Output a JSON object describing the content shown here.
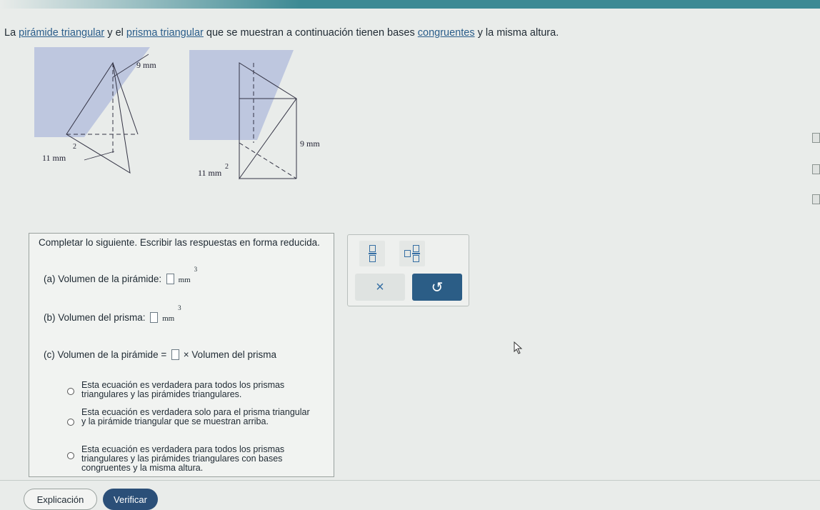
{
  "intro": {
    "part1": "La ",
    "link1": "pirámide triangular",
    "part2": " y el ",
    "link2": "prisma triangular",
    "part3": " que se muestran a continuación tienen bases ",
    "link3": "congruentes",
    "part4": " y la misma altura."
  },
  "figures": {
    "pyramid": {
      "height_label": "9 mm",
      "base_label": "11 mm",
      "base_exp": "2"
    },
    "prism": {
      "height_label": "9 mm",
      "base_label": "11 mm",
      "base_exp": "2"
    }
  },
  "panel": {
    "instruction": "Completar lo siguiente. Escribir las respuestas en forma reducida.",
    "a": {
      "label": "(a) Volumen de la pirámide:",
      "unit": "mm",
      "unit_exp": "3"
    },
    "b": {
      "label": "(b) Volumen del prisma:",
      "unit": "mm",
      "unit_exp": "3"
    },
    "c": {
      "label_prefix": "(c) Volumen de la pirámide",
      "eq": "=",
      "times": "×",
      "label_suffix": "Volumen del prisma"
    },
    "options": [
      "Esta ecuación es verdadera para todos los prismas triangulares y las pirámides triangulares.",
      "Esta ecuación es verdadera solo para el prisma triangular y la pirámide triangular que se muestran arriba.",
      "Esta ecuación es verdadera para todos los prismas triangulares y las pirámides triangulares con bases congruentes y la misma altura."
    ]
  },
  "tools": {
    "clear_symbol": "×",
    "undo_symbol": "↺"
  },
  "footer": {
    "explain_label": "Explicación",
    "verify_label": "Verificar"
  },
  "colors": {
    "accent": "#2b5d86",
    "topbar": "#3d8a94",
    "shade": "#b9c3de"
  }
}
